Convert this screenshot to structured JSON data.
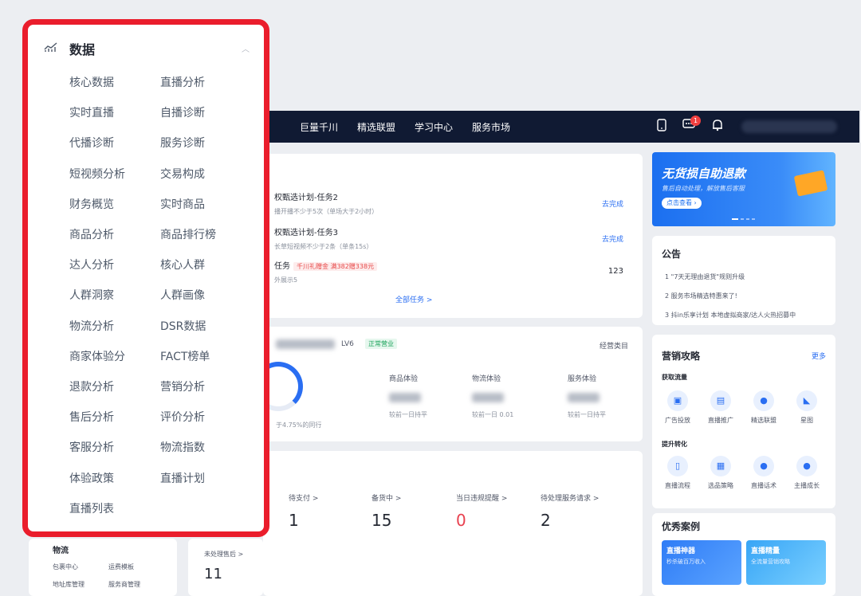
{
  "topbar": {
    "nav": [
      "巨量千川",
      "精选联盟",
      "学习中心",
      "服务市场"
    ],
    "message_badge": "1",
    "icons": [
      "phone-icon",
      "message-icon",
      "bell-icon"
    ]
  },
  "tasks": {
    "rows": [
      {
        "title": "权甄选计划-任务2",
        "sub": "播开播不少于5次（单场大于2小时）",
        "action": "去完成"
      },
      {
        "title": "权甄选计划-任务3",
        "sub": "长草短视频不少于2条（单条15s）",
        "action": "去完成"
      },
      {
        "title": "任务",
        "tag": "千川礼赠金 满382赠338元",
        "sub": "外展示5",
        "action": "123"
      }
    ],
    "all_link": "全部任务 >"
  },
  "shop": {
    "level": "LV6",
    "status": "正常营业",
    "category_link": "经营类目",
    "ring_note": "于4.75%的同行",
    "metrics": [
      {
        "label": "商品体验",
        "foot": "较前一日持平"
      },
      {
        "label": "物流体验",
        "foot": "较前一日 0.01"
      },
      {
        "label": "服务体验",
        "foot": "较前一日持平"
      }
    ]
  },
  "orders": {
    "stats": [
      {
        "label": "待支付 >",
        "value": "1"
      },
      {
        "label": "备货中 >",
        "value": "15"
      },
      {
        "label": "当日违规提醒 >",
        "value": "0",
        "color": "#e8414f"
      },
      {
        "label": "待处理服务请求 >",
        "value": "2"
      }
    ],
    "after_sale": {
      "label": "未处理售后 >",
      "value": "11"
    }
  },
  "bottom_left": {
    "title": "物流",
    "links": [
      "包裹中心",
      "运费模板",
      "地址库管理",
      "服务商管理"
    ]
  },
  "banner": {
    "title": "无货损自助退款",
    "subtitle": "售后自动处理，解放售后客服",
    "button": "点击查看 ›"
  },
  "notice": {
    "title": "公告",
    "items": [
      "1 \"7天无理由退货\"规则升级",
      "2 服务市场精选特惠来了!",
      "3 抖in乐享计划 本地虚拟商家/达人火热招募中"
    ]
  },
  "marketing": {
    "title": "营销攻略",
    "more": "更多",
    "groups": [
      {
        "title": "获取流量",
        "tools": [
          "广告投放",
          "直播推广",
          "精选联盟",
          "星图"
        ]
      },
      {
        "title": "提升转化",
        "tools": [
          "直播流程",
          "选品策略",
          "直播话术",
          "主播成长"
        ]
      }
    ]
  },
  "cases": {
    "title": "优秀案例",
    "items": [
      {
        "title": "直播神器",
        "sub": "秒杀破百万收入"
      },
      {
        "title": "直播精量",
        "sub": "全流量营销攻略"
      }
    ]
  },
  "data_menu": {
    "title": "数据",
    "items": [
      "核心数据",
      "直播分析",
      "实时直播",
      "自播诊断",
      "代播诊断",
      "服务诊断",
      "短视频分析",
      "交易构成",
      "财务概览",
      "实时商品",
      "商品分析",
      "商品排行榜",
      "达人分析",
      "核心人群",
      "人群洞察",
      "人群画像",
      "物流分析",
      "DSR数据",
      "商家体验分",
      "FACT榜单",
      "退款分析",
      "营销分析",
      "售后分析",
      "评价分析",
      "客服分析",
      "物流指数",
      "体验政策",
      "直播计划",
      "直播列表"
    ]
  },
  "colors": {
    "highlight": "#ea1d2c",
    "nav_bg": "#101a33",
    "accent": "#2a6ef2"
  }
}
